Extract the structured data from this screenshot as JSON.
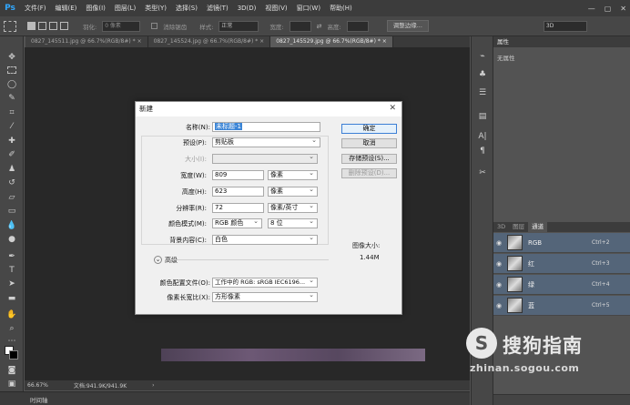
{
  "app": {
    "logo": "Ps",
    "window_controls": [
      "—",
      "▢",
      "✕"
    ]
  },
  "menu": [
    "文件(F)",
    "编辑(E)",
    "图像(I)",
    "图层(L)",
    "类型(Y)",
    "选择(S)",
    "滤镜(T)",
    "3D(D)",
    "视图(V)",
    "窗口(W)",
    "帮助(H)"
  ],
  "options": {
    "feather_label": "羽化:",
    "feather_value": "0 像素",
    "antialias_label": "消除锯齿",
    "style_label": "样式:",
    "style_value": "正常",
    "width_label": "宽度:",
    "height_label": "高度:",
    "refine_button": "调整边缘...",
    "workspace": "3D"
  },
  "tabs": [
    {
      "label": "0827_145511.jpg @ 66.7%(RGB/8#) *",
      "close": "×"
    },
    {
      "label": "0827_145524.jpg @ 66.7%(RGB/8#) *",
      "close": "×"
    },
    {
      "label": "0827_145529.jpg @ 66.7%(RGB/8#) *",
      "close": "×"
    }
  ],
  "status": {
    "zoom": "66.67%",
    "doc_size": "文档:941.9K/941.9K"
  },
  "timeline_label": "时间轴",
  "properties": {
    "title": "属性",
    "body": "无属性"
  },
  "channels": {
    "tabs": [
      "3D",
      "图层",
      "通道"
    ],
    "rows": [
      {
        "name": "RGB",
        "shortcut": "Ctrl+2"
      },
      {
        "name": "红",
        "shortcut": "Ctrl+3"
      },
      {
        "name": "绿",
        "shortcut": "Ctrl+4"
      },
      {
        "name": "蓝",
        "shortcut": "Ctrl+5"
      }
    ]
  },
  "dialog": {
    "title": "新建",
    "name_label": "名称(N):",
    "name_value": "未标题-1",
    "preset_label": "预设(P):",
    "preset_value": "剪贴板",
    "size_label": "大小(I):",
    "width_label": "宽度(W):",
    "width_value": "809",
    "width_unit": "像素",
    "height_label": "高度(H):",
    "height_value": "623",
    "height_unit": "像素",
    "resolution_label": "分辨率(R):",
    "resolution_value": "72",
    "resolution_unit": "像素/英寸",
    "color_mode_label": "颜色模式(M):",
    "color_mode_value": "RGB 颜色",
    "bit_depth_value": "8 位",
    "bg_label": "背景内容(C):",
    "bg_value": "白色",
    "advanced_label": "高级",
    "profile_label": "颜色配置文件(O):",
    "profile_value": "工作中的 RGB: sRGB IEC6196...",
    "aspect_label": "像素长宽比(X):",
    "aspect_value": "方形像素",
    "ok_button": "确定",
    "cancel_button": "取消",
    "save_preset_button": "存储预设(S)...",
    "delete_preset_button": "删除预设(D)...",
    "image_size_label": "图像大小:",
    "image_size_value": "1.44M"
  },
  "watermark": {
    "logo": "S",
    "brand": "搜狗指南",
    "url": "zhinan.sogou.com"
  }
}
